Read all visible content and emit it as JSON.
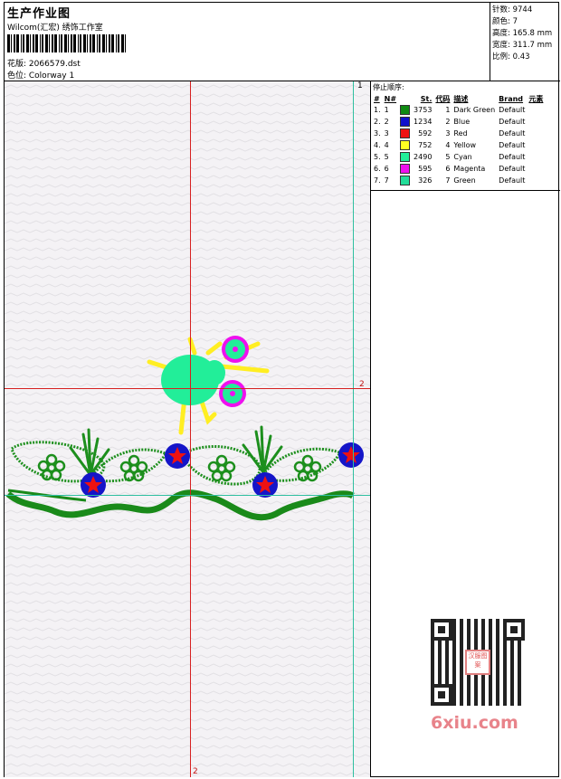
{
  "header": {
    "title": "生产作业图",
    "subtitle": "Wilcom(汇宏) 绣饰工作室",
    "design": "花版: 2066579.dst",
    "colorway": "色位: Colorway 1",
    "stats": [
      {
        "label": "针数",
        "value": "9744"
      },
      {
        "label": "颜色",
        "value": "7"
      },
      {
        "label": "高度",
        "value": "165.8 mm"
      },
      {
        "label": "宽度",
        "value": "311.7 mm"
      },
      {
        "label": "比例",
        "value": "0.43"
      }
    ]
  },
  "guides": {
    "top_label": "1",
    "right_label": "2",
    "bottom_label": "2"
  },
  "stop_sequence": {
    "title": "停止顺序:",
    "columns": [
      "#",
      "N#",
      "St.",
      "代码",
      "描述",
      "Brand",
      "元素"
    ],
    "rows": [
      {
        "idx": "1.",
        "n": "1",
        "color": "#0f8a12",
        "st": "3753",
        "code": "1",
        "desc": "Dark Green",
        "brand": "Default"
      },
      {
        "idx": "2.",
        "n": "2",
        "color": "#1010cc",
        "st": "1234",
        "code": "2",
        "desc": "Blue",
        "brand": "Default"
      },
      {
        "idx": "3.",
        "n": "3",
        "color": "#ee1111",
        "st": "592",
        "code": "3",
        "desc": "Red",
        "brand": "Default"
      },
      {
        "idx": "4.",
        "n": "4",
        "color": "#ffff22",
        "st": "752",
        "code": "4",
        "desc": "Yellow",
        "brand": "Default"
      },
      {
        "idx": "5.",
        "n": "5",
        "color": "#22ee99",
        "st": "2490",
        "code": "5",
        "desc": "Cyan",
        "brand": "Default"
      },
      {
        "idx": "6.",
        "n": "6",
        "color": "#ee11ee",
        "st": "595",
        "code": "6",
        "desc": "Magenta",
        "brand": "Default"
      },
      {
        "idx": "7.",
        "n": "7",
        "color": "#22dd99",
        "st": "326",
        "code": "7",
        "desc": "Green",
        "brand": "Default"
      }
    ]
  },
  "watermark": {
    "stamp": "汉服图案",
    "site": "6xiu.com"
  }
}
